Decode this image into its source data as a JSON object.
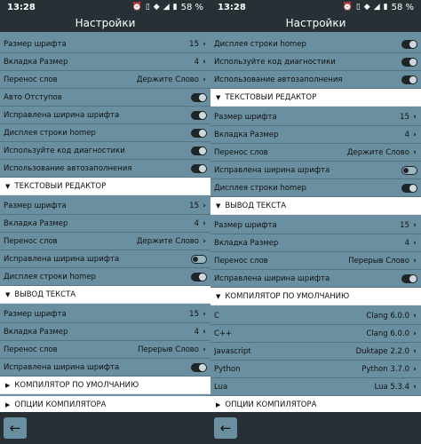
{
  "status": {
    "time": "13:28",
    "battery": "58 %",
    "icons": [
      "alarm-icon",
      "vibrate-icon",
      "wifi-icon",
      "signal-icon",
      "battery-icon"
    ]
  },
  "title": "Настройки",
  "left": {
    "rows": [
      {
        "kind": "item",
        "label": "Размер шрифта",
        "value": "15",
        "ctl": "chevron"
      },
      {
        "kind": "item",
        "label": "Вкладка Размер",
        "value": "4",
        "ctl": "chevron"
      },
      {
        "kind": "item",
        "label": "Перенос слов",
        "value": "Держите Слово",
        "ctl": "chevron"
      },
      {
        "kind": "item",
        "label": "Авто Отступов",
        "ctl": "toggle",
        "on": true
      },
      {
        "kind": "item",
        "label": "Исправлена ширина шрифта",
        "ctl": "toggle",
        "on": true
      },
      {
        "kind": "item",
        "label": "Дисплея строки homер",
        "ctl": "toggle",
        "on": true
      },
      {
        "kind": "item",
        "label": "Используйте код диагностики",
        "ctl": "toggle",
        "on": true
      },
      {
        "kind": "item",
        "label": "Использование автозаполнения",
        "ctl": "toggle",
        "on": true
      },
      {
        "kind": "section",
        "label": "ТЕКСТОВЫЙ РЕДАКТОР",
        "expanded": true
      },
      {
        "kind": "item",
        "label": "Размер шрифта",
        "value": "15",
        "ctl": "chevron"
      },
      {
        "kind": "item",
        "label": "Вкладка Размер",
        "value": "4",
        "ctl": "chevron"
      },
      {
        "kind": "item",
        "label": "Перенос слов",
        "value": "Держите Слово",
        "ctl": "chevron"
      },
      {
        "kind": "item",
        "label": "Исправлена ширина шрифта",
        "ctl": "toggle",
        "on": false
      },
      {
        "kind": "item",
        "label": "Дисплея строки homер",
        "ctl": "toggle",
        "on": true
      },
      {
        "kind": "section",
        "label": "ВЫВОД ТЕКСТА",
        "expanded": true
      },
      {
        "kind": "item",
        "label": "Размер шрифта",
        "value": "15",
        "ctl": "chevron"
      },
      {
        "kind": "item",
        "label": "Вкладка Размер",
        "value": "4",
        "ctl": "chevron"
      },
      {
        "kind": "item",
        "label": "Перенос слов",
        "value": "Перерыв Слово",
        "ctl": "chevron"
      },
      {
        "kind": "item",
        "label": "Исправлена ширина шрифта",
        "ctl": "toggle",
        "on": true
      },
      {
        "kind": "section",
        "label": "КОМПИЛЯТОР ПО УМОЛЧАНИЮ",
        "expanded": false
      },
      {
        "kind": "section",
        "label": "ОПЦИИ КОМПИЛЯТОРА",
        "expanded": false
      }
    ]
  },
  "right": {
    "rows": [
      {
        "kind": "item",
        "label": "Дисплея строки homер",
        "ctl": "toggle",
        "on": true
      },
      {
        "kind": "item",
        "label": "Используйте код диагностики",
        "ctl": "toggle",
        "on": true
      },
      {
        "kind": "item",
        "label": "Использование автозаполнения",
        "ctl": "toggle",
        "on": true
      },
      {
        "kind": "section",
        "label": "ТЕКСТОВЫЙ РЕДАКТОР",
        "expanded": true
      },
      {
        "kind": "item",
        "label": "Размер шрифта",
        "value": "15",
        "ctl": "chevron"
      },
      {
        "kind": "item",
        "label": "Вкладка Размер",
        "value": "4",
        "ctl": "chevron"
      },
      {
        "kind": "item",
        "label": "Перенос слов",
        "value": "Держите Слово",
        "ctl": "chevron"
      },
      {
        "kind": "item",
        "label": "Исправлена ширина шрифта",
        "ctl": "toggle",
        "on": false
      },
      {
        "kind": "item",
        "label": "Дисплея строки homер",
        "ctl": "toggle",
        "on": true
      },
      {
        "kind": "section",
        "label": "ВЫВОД ТЕКСТА",
        "expanded": true
      },
      {
        "kind": "item",
        "label": "Размер шрифта",
        "value": "15",
        "ctl": "chevron"
      },
      {
        "kind": "item",
        "label": "Вкладка Размер",
        "value": "4",
        "ctl": "chevron"
      },
      {
        "kind": "item",
        "label": "Перенос слов",
        "value": "Перерыв Слово",
        "ctl": "chevron"
      },
      {
        "kind": "item",
        "label": "Исправлена ширина шрифта",
        "ctl": "toggle",
        "on": true
      },
      {
        "kind": "section",
        "label": "КОМПИЛЯТОР ПО УМОЛЧАНИЮ",
        "expanded": true
      },
      {
        "kind": "item",
        "label": "C",
        "value": "Clang 6.0.0",
        "ctl": "chevron"
      },
      {
        "kind": "item",
        "label": "C++",
        "value": "Clang 6.0.0",
        "ctl": "chevron"
      },
      {
        "kind": "item",
        "label": "Javascript",
        "value": "Duktape 2.2.0",
        "ctl": "chevron"
      },
      {
        "kind": "item",
        "label": "Python",
        "value": "Python 3.7.0",
        "ctl": "chevron"
      },
      {
        "kind": "item",
        "label": "Lua",
        "value": "Lua 5.3.4",
        "ctl": "chevron"
      },
      {
        "kind": "section",
        "label": "ОПЦИИ КОМПИЛЯТОРА",
        "expanded": false
      }
    ]
  },
  "nav": {
    "back_icon": "arrow-left-icon"
  }
}
